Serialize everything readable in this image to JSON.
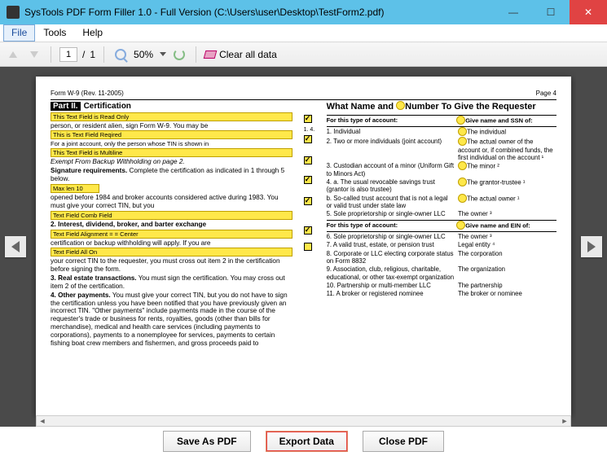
{
  "titlebar": {
    "text": "SysTools PDF Form Filler 1.0 - Full Version (C:\\Users\\user\\Desktop\\TestForm2.pdf)"
  },
  "menu": {
    "file": "File",
    "tools": "Tools",
    "help": "Help"
  },
  "toolbar": {
    "page_current": "1",
    "page_sep": "/",
    "page_total": "1",
    "zoom": "50%",
    "clear": "Clear all data"
  },
  "doc": {
    "form_id": "Form W-9 (Rev. 11-2005)",
    "page_label": "Page 4",
    "part_label": "Part II.",
    "part_name": "Certification",
    "left": {
      "ro": "This Text Field is Read Only",
      "l1": "person, or resident alien, sign Form W-9. You may be",
      "req": "This is Text Field Reqired",
      "l2": "For a joint account, only the person whose TIN is shown in",
      "ml": "This Text Field is Multiline",
      "l3": "Exempt From Backup Withholding on page 2.",
      "sig": "Signature requirements. Complete the certification as indicated in 1 through 5 below.",
      "max": "Max len 10",
      "l4": "opened before 1984 and broker accounts considered active during 1983. You must give your correct TIN, but you",
      "comb": "Text Field Comb Field",
      "h2": "2. Interest, dividend, broker, and barter exchange",
      "center": "Text Field Alignment = = Center",
      "l5": "certification or backup withholding will apply. If you are",
      "allon": "Text Field All On",
      "l6": "your correct TIN to the requester, you must cross out item 2 in the certification before signing the form.",
      "h3": "3. Real estate transactions. You must sign the certification. You may cross out item 2 of the certification.",
      "h4": "4. Other payments. You must give your correct TIN, but you do not have to sign the certification unless you have been notified that you have previously given an incorrect TIN. \"Other payments\" include payments made in the course of the requester's trade or business for rents, royalties, goods (other than bills for merchandise), medical and health care services (including payments to corporations), payments to a nonemployee for services, payments to certain fishing boat crew members and fishermen, and gross proceeds paid to"
    },
    "right": {
      "title": "What Name and Number To Give the Requester",
      "hdr1a": "For this type of account:",
      "hdr1b": "Give name and SSN of:",
      "rows1": [
        {
          "n": "1.",
          "a": "Individual",
          "b": "The individual"
        },
        {
          "n": "2.",
          "a": "Two or more individuals (joint account)",
          "b": "The actual owner of the account or, if combined funds, the first individual on the account ¹"
        },
        {
          "n": "3.",
          "a": "Custodian account of a minor (Uniform Gift to Minors Act)",
          "b": "The minor ²"
        },
        {
          "n": "4.",
          "a": "a. The usual revocable savings trust (grantor is also trustee)",
          "b": "The grantor-trustee ¹"
        },
        {
          "n": "",
          "a": "b. So-called trust account that is not a legal or valid trust under state law",
          "b": "The actual owner ¹"
        },
        {
          "n": "5.",
          "a": "Sole proprietorship or single-owner LLC",
          "b": "The owner ³"
        }
      ],
      "hdr2a": "For this type of account:",
      "hdr2b": "Give name and EIN of:",
      "rows2": [
        {
          "n": "6.",
          "a": "Sole proprietorship or single-owner LLC",
          "b": "The owner ³"
        },
        {
          "n": "7.",
          "a": "A valid trust, estate, or pension trust",
          "b": "Legal entity ⁴"
        },
        {
          "n": "8.",
          "a": "Corporate or LLC electing corporate status on Form 8832",
          "b": "The corporation"
        },
        {
          "n": "9.",
          "a": "Association, club, religious, charitable, educational, or other tax-exempt organization",
          "b": "The organization"
        },
        {
          "n": "10.",
          "a": "Partnership or multi-member LLC",
          "b": "The partnership"
        },
        {
          "n": "11.",
          "a": "A broker or registered nominee",
          "b": "The broker or nominee"
        }
      ]
    },
    "side_num": "1. 4."
  },
  "footer": {
    "save": "Save As PDF",
    "export": "Export Data",
    "close": "Close PDF"
  }
}
